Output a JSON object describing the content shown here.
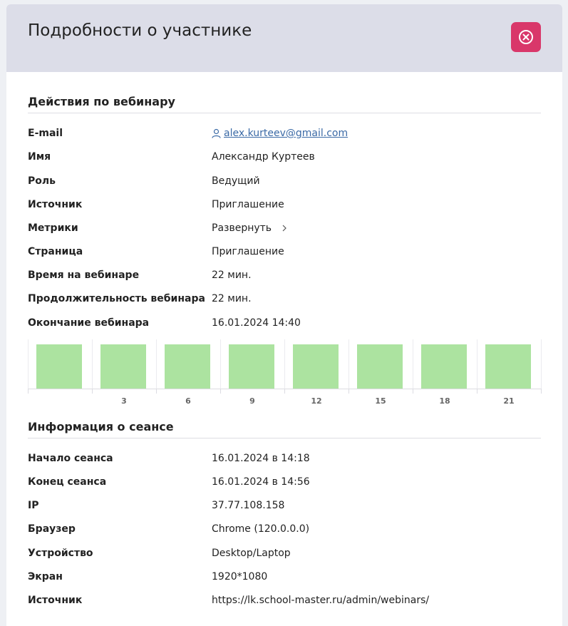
{
  "header": {
    "title": "Подробности о участнике",
    "close_icon": "close-circle-icon",
    "close_color": "#d9376a"
  },
  "webinar_section": {
    "title": "Действия по вебинару",
    "rows": [
      {
        "label": "E-mail",
        "value": "alex.kurteev@gmail.com"
      },
      {
        "label": "Имя",
        "value": "Александр Куртеев"
      },
      {
        "label": "Роль",
        "value": "Ведущий"
      },
      {
        "label": "Источник",
        "value": "Приглашение"
      },
      {
        "label": "Метрики",
        "value": "Развернуть"
      },
      {
        "label": "Страница",
        "value": "Приглашение"
      },
      {
        "label": "Время на вебинаре",
        "value": "22 мин."
      },
      {
        "label": "Продолжительность вебинара",
        "value": "22 мин."
      },
      {
        "label": "Окончание вебинара",
        "value": "16.01.2024 14:40"
      }
    ]
  },
  "chart_data": {
    "type": "bar",
    "x_ticks": [
      "3",
      "6",
      "9",
      "12",
      "15",
      "18",
      "21"
    ],
    "values": [
      1,
      1,
      1,
      1,
      1,
      1,
      1,
      1
    ],
    "bar_color": "#ace3a0",
    "grid": true
  },
  "session_section": {
    "title": "Информация о сеансе",
    "rows": [
      {
        "label": "Начало сеанса",
        "value": "16.01.2024 в 14:18"
      },
      {
        "label": "Конец сеанса",
        "value": "16.01.2024 в 14:56"
      },
      {
        "label": "IP",
        "value": "37.77.108.158"
      },
      {
        "label": "Браузер",
        "value": "Chrome (120.0.0.0)"
      },
      {
        "label": "Устройство",
        "value": "Desktop/Laptop"
      },
      {
        "label": "Экран",
        "value": "1920*1080"
      },
      {
        "label": "Источник",
        "value": "https://lk.school-master.ru/admin/webinars/"
      }
    ]
  }
}
